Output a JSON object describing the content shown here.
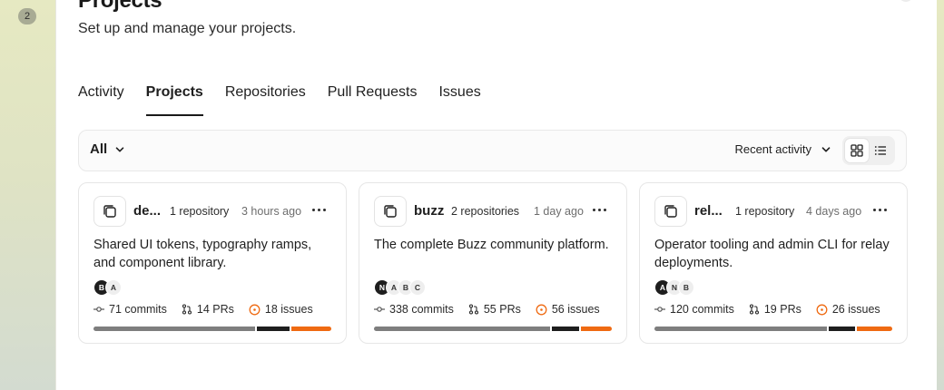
{
  "rail": {
    "badge": "2"
  },
  "header": {
    "title": "Projects",
    "subtitle": "Set up and manage your projects."
  },
  "tabs": [
    {
      "label": "Activity",
      "active": false
    },
    {
      "label": "Projects",
      "active": true
    },
    {
      "label": "Repositories",
      "active": false
    },
    {
      "label": "Pull Requests",
      "active": false
    },
    {
      "label": "Issues",
      "active": false
    }
  ],
  "toolbar": {
    "filter_label": "All",
    "sort_label": "Recent activity",
    "view_active": "grid"
  },
  "colors": {
    "accent": "#ef6a12",
    "dark": "#1e1e1e",
    "muted": "#7e7e7e"
  },
  "cards": [
    {
      "name": "de...",
      "repos": "1 repository",
      "time": "3 hours ago",
      "description": "Shared UI tokens, typography ramps, and component library.",
      "avatars": [
        {
          "initial": "B",
          "style": "dark"
        },
        {
          "initial": "A",
          "style": "light"
        }
      ],
      "commits": "71 commits",
      "prs": "14 PRs",
      "issues": "18 issues",
      "bar": {
        "commits_fraction": 0.69,
        "prs_fraction": 0.14,
        "issues_fraction": 0.17
      }
    },
    {
      "name": "buzz",
      "repos": "2 repositories",
      "time": "1 day ago",
      "description": "The complete Buzz community platform.",
      "avatars": [
        {
          "initial": "N",
          "style": "dark"
        },
        {
          "initial": "A",
          "style": "light"
        },
        {
          "initial": "B",
          "style": "light"
        },
        {
          "initial": "C",
          "style": "light"
        }
      ],
      "commits": "338 commits",
      "prs": "55 PRs",
      "issues": "56 issues",
      "bar": {
        "commits_fraction": 0.75,
        "prs_fraction": 0.12,
        "issues_fraction": 0.13
      }
    },
    {
      "name": "rel...",
      "repos": "1 repository",
      "time": "4 days ago",
      "description": "Operator tooling and admin CLI for relay deployments.",
      "avatars": [
        {
          "initial": "A",
          "style": "dark"
        },
        {
          "initial": "N",
          "style": "light"
        },
        {
          "initial": "B",
          "style": "light"
        }
      ],
      "commits": "120 commits",
      "prs": "19 PRs",
      "issues": "26 issues",
      "bar": {
        "commits_fraction": 0.78,
        "prs_fraction": 0.12,
        "issues_fraction": 0.16
      }
    }
  ]
}
